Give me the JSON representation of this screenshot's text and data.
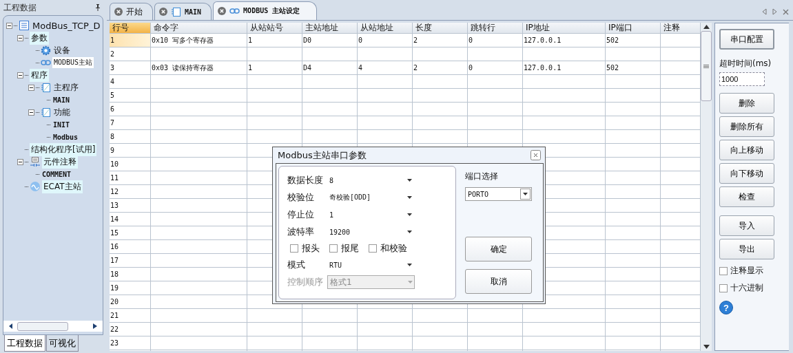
{
  "left_panel": {
    "title": "工程数据",
    "tree": [
      {
        "label": "ModBus_TCP_D",
        "kind": "doc",
        "expanded": true,
        "selected": false,
        "children": [
          {
            "label": "参数",
            "expanded": true,
            "selected": false,
            "children": [
              {
                "label": "设备",
                "kind": "gear",
                "selected": false
              },
              {
                "label": "MODBUS主站",
                "kind": "link",
                "selected": true
              }
            ]
          },
          {
            "label": "程序",
            "expanded": true,
            "selected": false,
            "children": [
              {
                "label": "主程序",
                "kind": "block",
                "expanded": true,
                "selected": false,
                "children": [
                  {
                    "label": "MAIN",
                    "selected": false
                  }
                ]
              },
              {
                "label": "功能",
                "kind": "block",
                "expanded": true,
                "selected": false,
                "children": [
                  {
                    "label": "INIT",
                    "selected": false
                  },
                  {
                    "label": "Modbus",
                    "selected": false
                  }
                ]
              }
            ]
          },
          {
            "label": "结构化程序[试用]",
            "selected": false
          },
          {
            "label": "元件注释",
            "kind": "comment",
            "expanded": true,
            "selected": false,
            "children": [
              {
                "label": "COMMENT",
                "selected": false
              }
            ]
          },
          {
            "label": "ECAT主站",
            "kind": "wave",
            "selected": false
          }
        ]
      }
    ],
    "bottom_tabs": [
      {
        "label": "工程数据",
        "selected": true
      },
      {
        "label": "可视化",
        "selected": false
      }
    ]
  },
  "tabs": [
    {
      "label": "开始",
      "kind": "plain",
      "selected": false
    },
    {
      "label": "MAIN",
      "kind": "block",
      "selected": false
    },
    {
      "label": "MODBUS 主站设定",
      "kind": "link",
      "selected": true
    }
  ],
  "table": {
    "columns": [
      "行号",
      "命令字",
      "从站站号",
      "主站地址",
      "从站地址",
      "长度",
      "跳转行",
      "IP地址",
      "IP端口",
      "注释"
    ],
    "rows": [
      {
        "number": "1",
        "selected": true,
        "cells": [
          "0x10 写多个寄存器",
          "1",
          "D0",
          "0",
          "2",
          "0",
          "127.0.0.1",
          "502"
        ]
      },
      {
        "number": "2",
        "selected": false
      },
      {
        "number": "3",
        "selected": false,
        "cells": [
          "0x03 读保持寄存器",
          "1",
          "D4",
          "4",
          "2",
          "0",
          "127.0.0.1",
          "502"
        ]
      },
      {
        "number": "4",
        "selected": false
      },
      {
        "number": "5",
        "selected": false
      },
      {
        "number": "6",
        "selected": false
      },
      {
        "number": "7",
        "selected": false
      },
      {
        "number": "8",
        "selected": false
      },
      {
        "number": "9",
        "selected": false
      },
      {
        "number": "10",
        "selected": false
      },
      {
        "number": "11",
        "selected": false
      },
      {
        "number": "12",
        "selected": false
      },
      {
        "number": "13",
        "selected": false
      },
      {
        "number": "14",
        "selected": false
      },
      {
        "number": "15",
        "selected": false
      },
      {
        "number": "16",
        "selected": false
      },
      {
        "number": "17",
        "selected": false
      },
      {
        "number": "18",
        "selected": false
      },
      {
        "number": "19",
        "selected": false
      },
      {
        "number": "20",
        "selected": false
      },
      {
        "number": "21",
        "selected": false
      },
      {
        "number": "22",
        "selected": false
      },
      {
        "number": "23",
        "selected": false
      }
    ]
  },
  "dialog": {
    "title": "Modbus主站串口参数",
    "fields_top": [
      {
        "label": "数据长度",
        "value": "8",
        "disabled": false
      },
      {
        "label": "校验位",
        "value": "奇校验[ODD]",
        "disabled": false
      },
      {
        "label": "停止位",
        "value": "1",
        "disabled": false
      },
      {
        "label": "波特率",
        "value": "19200",
        "disabled": false
      }
    ],
    "checkboxes": [
      {
        "label": "报头",
        "checked": false
      },
      {
        "label": "报尾",
        "checked": false
      },
      {
        "label": "和校验",
        "checked": false
      }
    ],
    "fields_bottom": [
      {
        "label": "模式",
        "value": "RTU",
        "disabled": false
      },
      {
        "label": "控制顺序",
        "value": "格式1",
        "disabled": true
      }
    ],
    "port": {
      "label": "端口选择",
      "value": "PORTO"
    },
    "buttons": [
      "确定",
      "取消"
    ]
  },
  "right_panel": {
    "config_button": "串口配置",
    "timeout_label": "超时时间(ms)",
    "timeout_value": "1000",
    "buttons": [
      "删除",
      "删除所有",
      "向上移动",
      "向下移动",
      "检查"
    ],
    "io_buttons": [
      "导入",
      "导出"
    ],
    "checkboxes": [
      {
        "label": "注释显示",
        "checked": false
      },
      {
        "label": "十六进制",
        "checked": false
      }
    ],
    "help": "?"
  }
}
